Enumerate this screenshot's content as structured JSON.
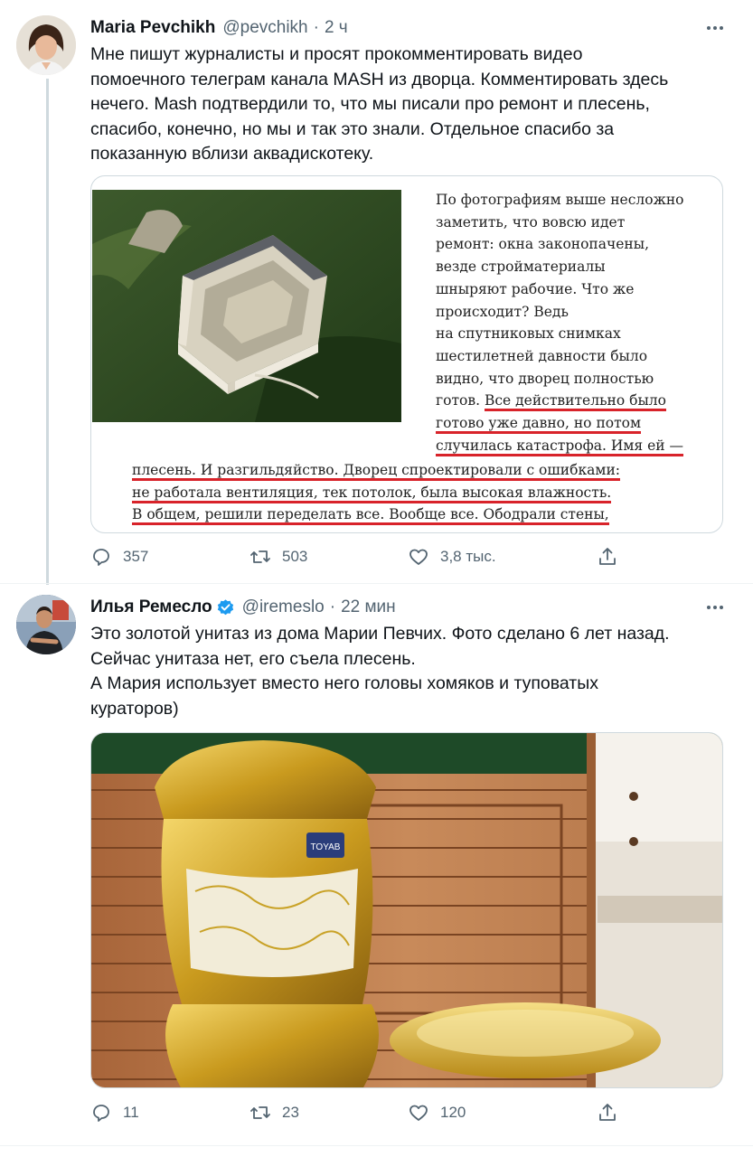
{
  "tweet1": {
    "author_name": "Maria Pevchikh",
    "handle": "@pevchikh",
    "separator": "·",
    "time": "2 ч",
    "text_lines": [
      "Мне пишут журналисты и просят прокомментировать видео",
      "помоечного телеграм канала MASH из дворца. Комментировать здесь",
      "нечего. Mash подтвердили то, что мы писали про ремонт и плесень,",
      "спасибо, конечно, но мы и так это знали. Отдельное спасибо за",
      "показанную вблизи аквадискотеку."
    ],
    "article_column_lines": [
      "По фотографиям выше несложно",
      "заметить, что вовсю идет",
      "ремонт: окна законопачены,",
      "везде стройматериалы",
      "шныряют рабочие. Что же",
      "происходит? Ведь",
      "на спутниковых снимках",
      "шестилетней давности было",
      "видно, что дворец полностью"
    ],
    "article_underlined_start_plain": "готов. ",
    "article_underlined_start": "Все действительно было",
    "article_underlined_lines": [
      "готово уже давно, но потом",
      "случилась катастрофа. Имя ей —"
    ],
    "article_wide_lines": [
      "плесень. И разгильдяйство. Дворец спроектировали с ошибками:",
      "не работала вентиляция, тек потолок, была высокая влажность.",
      "В общем, решили переделать все. Вообще все. Ободрали стены,"
    ],
    "reply_count": "357",
    "retweet_count": "503",
    "like_count": "3,8 тыс."
  },
  "tweet2": {
    "author_name": "Илья Ремесло",
    "handle": "@iremeslo",
    "separator": "·",
    "time": "22 мин",
    "text_lines": [
      "Это золотой унитаз из дома Марии Певчих. Фото сделано 6 лет назад.",
      "Сейчас унитаза нет, его съела плесень.",
      "А Мария использует вместо него головы хомяков и туповатых",
      "кураторов)"
    ],
    "image_label": "TOYAB",
    "reply_count": "11",
    "retweet_count": "23",
    "like_count": "120"
  },
  "colors": {
    "text": "#0f1419",
    "secondary": "#536471",
    "border": "#cfd9de",
    "verified": "#1d9bf0",
    "underline": "#d8232a",
    "gold": "#c9a227"
  },
  "icons": [
    "more-icon",
    "reply-icon",
    "retweet-icon",
    "like-icon",
    "share-icon",
    "verified-badge-icon"
  ]
}
